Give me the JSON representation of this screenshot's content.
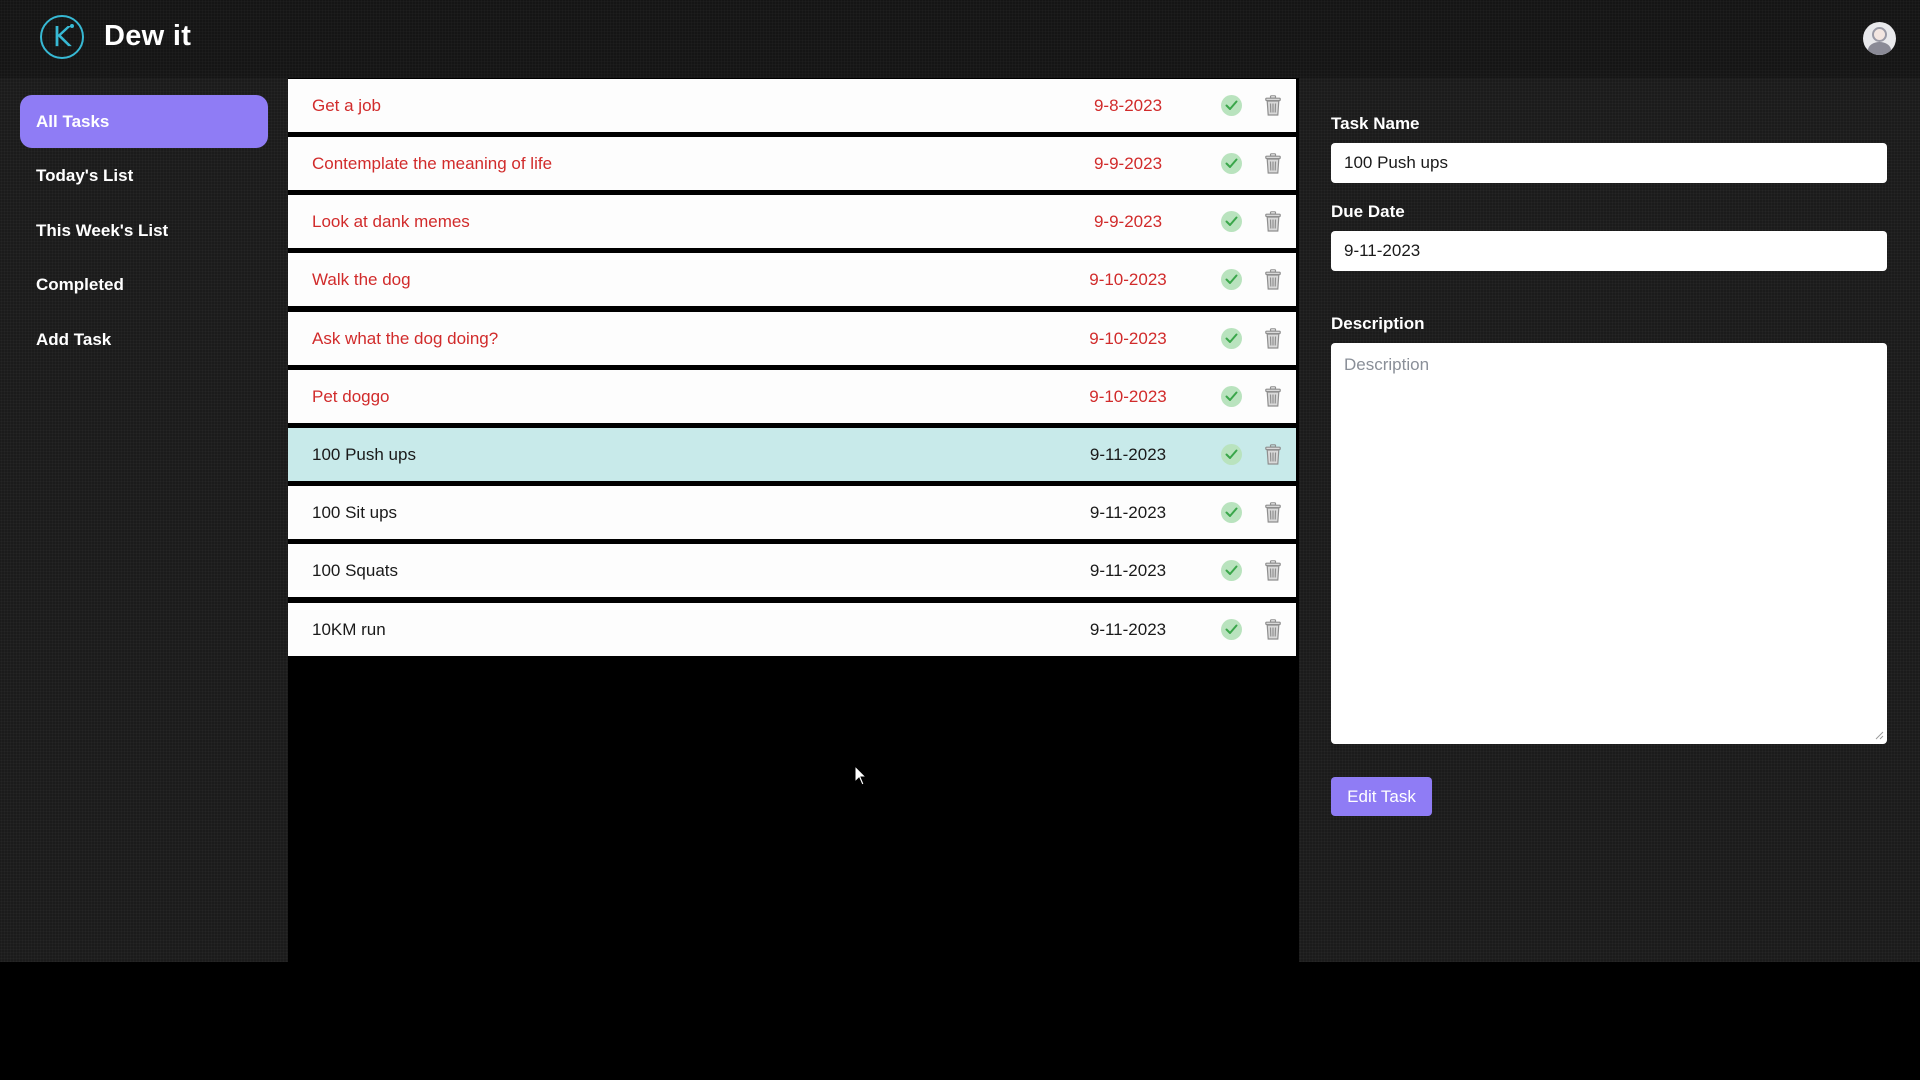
{
  "app": {
    "title": "Dew it",
    "logo_letter": "K"
  },
  "sidebar": {
    "items": [
      {
        "label": "All Tasks",
        "active": true
      },
      {
        "label": "Today's List",
        "active": false
      },
      {
        "label": "This Week's List",
        "active": false
      },
      {
        "label": "Completed",
        "active": false
      },
      {
        "label": "Add Task",
        "active": false
      }
    ]
  },
  "tasks": [
    {
      "name": "Get a job",
      "date": "9-8-2023",
      "overdue": true
    },
    {
      "name": "Contemplate the meaning of life",
      "date": "9-9-2023",
      "overdue": true
    },
    {
      "name": "Look at dank memes",
      "date": "9-9-2023",
      "overdue": true
    },
    {
      "name": "Walk the dog",
      "date": "9-10-2023",
      "overdue": true
    },
    {
      "name": "Ask what the dog doing?",
      "date": "9-10-2023",
      "overdue": true
    },
    {
      "name": "Pet doggo",
      "date": "9-10-2023",
      "overdue": true
    },
    {
      "name": "100 Push ups",
      "date": "9-11-2023",
      "overdue": false,
      "selected": true
    },
    {
      "name": "100 Sit ups",
      "date": "9-11-2023",
      "overdue": false
    },
    {
      "name": "100 Squats",
      "date": "9-11-2023",
      "overdue": false
    },
    {
      "name": "10KM run",
      "date": "9-11-2023",
      "overdue": false
    }
  ],
  "edit_panel": {
    "task_name_label": "Task Name",
    "task_name_value": "100 Push ups",
    "due_date_label": "Due Date",
    "due_date_value": "9-11-2023",
    "description_label": "Description",
    "description_placeholder": "Description",
    "submit_label": "Edit Task"
  },
  "colors": {
    "accent": "#8f7cf5",
    "overdue_text": "#d12b2b",
    "selected_row": "#c8eaea",
    "logo": "#37b9d4",
    "check_bg": "#b9e3be"
  },
  "icons": {
    "complete": "check-icon",
    "delete": "trash-icon"
  }
}
